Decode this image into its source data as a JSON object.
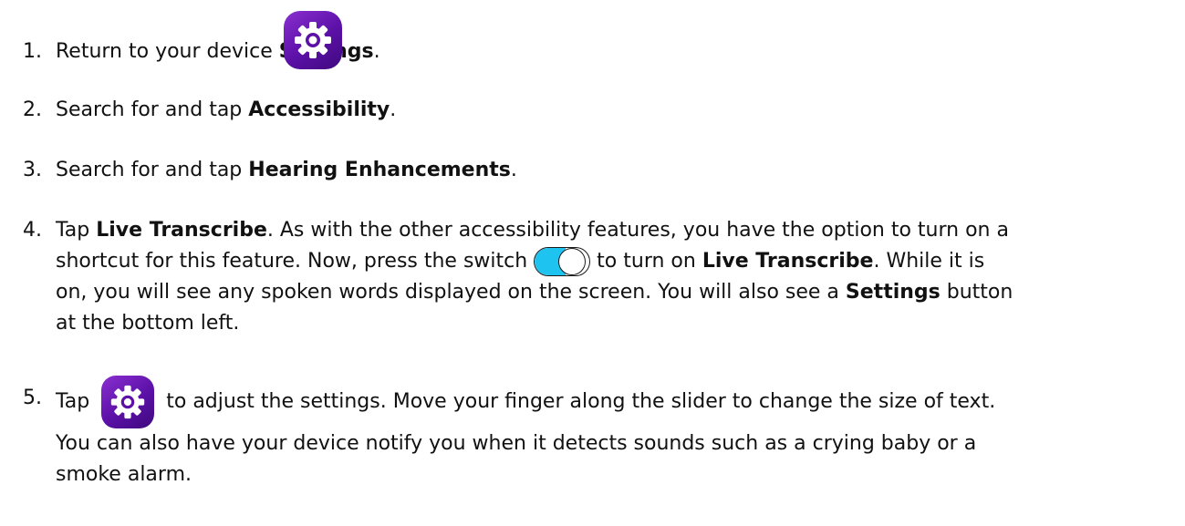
{
  "steps": [
    {
      "number": "1.",
      "parts": [
        "Return to your device ",
        "Settings",
        "."
      ],
      "icon": "settings-gear-icon"
    },
    {
      "number": "2.",
      "parts": [
        "Search for and tap ",
        "Accessibility",
        "."
      ]
    },
    {
      "number": "3.",
      "parts": [
        "Search for and tap ",
        "Hearing Enhancements",
        "."
      ]
    },
    {
      "number": "4.",
      "line1": [
        "Tap ",
        "Live Transcribe",
        ". As with the other accessibility features, you have the option to turn on a"
      ],
      "line2": [
        "shortcut for this feature. Now, press the switch ",
        " to turn on ",
        "Live Transcribe",
        ". While it is"
      ],
      "line3": "on, you will see any spoken words displayed on the screen. You will also see a ",
      "line3_bold": "Settings",
      "line3_end": " button",
      "line4": "at the bottom left.",
      "icon": "toggle-switch-icon"
    },
    {
      "number": "5.",
      "line1": [
        "Tap ",
        " to adjust the settings. Move your finger along the slider to change the size of text."
      ],
      "line2": "You can also have your device notify you when it detects sounds such as a crying baby or a",
      "line3": "smoke alarm.",
      "icon": "settings-gear-icon"
    }
  ],
  "colors": {
    "gear_background": "#6a1bb5",
    "toggle_on": "#1ec3f0"
  }
}
